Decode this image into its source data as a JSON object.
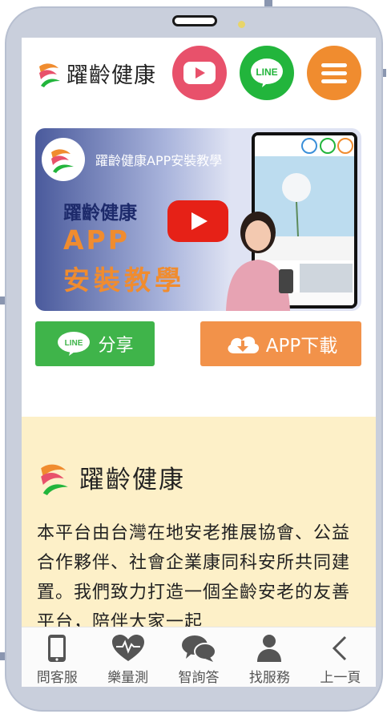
{
  "header": {
    "brand": "躍齡健康",
    "youtube_icon": "youtube-icon",
    "line_label": "LINE",
    "menu_icon": "hamburger-icon",
    "colors": {
      "youtube": "#e8516b",
      "line": "#22b53c",
      "menu": "#f08c2f"
    }
  },
  "video": {
    "title": "躍齡健康APP安裝教學",
    "brand": "躍齡健康",
    "app": "APP",
    "install": "安裝教學"
  },
  "actions": {
    "line_share": "分享",
    "line_share_icon_label": "LINE",
    "app_download": "APP下載",
    "colors": {
      "line": "#3fb44a",
      "app": "#f2924a"
    }
  },
  "about": {
    "title": "躍齡健康",
    "text": "本平台由台灣在地安老推展協會、公益合作夥伴、社會企業康同科安所共同建置。我們致力打造一個全齡安老的友善平台，陪伴大家一起",
    "bg": "#fdf0c8"
  },
  "tabbar": {
    "items": [
      {
        "label": "問客服",
        "icon": "phone-icon"
      },
      {
        "label": "樂量測",
        "icon": "heartbeat-icon"
      },
      {
        "label": "智詢答",
        "icon": "chat-bubbles-icon"
      },
      {
        "label": "找服務",
        "icon": "person-icon"
      },
      {
        "label": "上一頁",
        "icon": "chevron-left-icon"
      }
    ]
  }
}
